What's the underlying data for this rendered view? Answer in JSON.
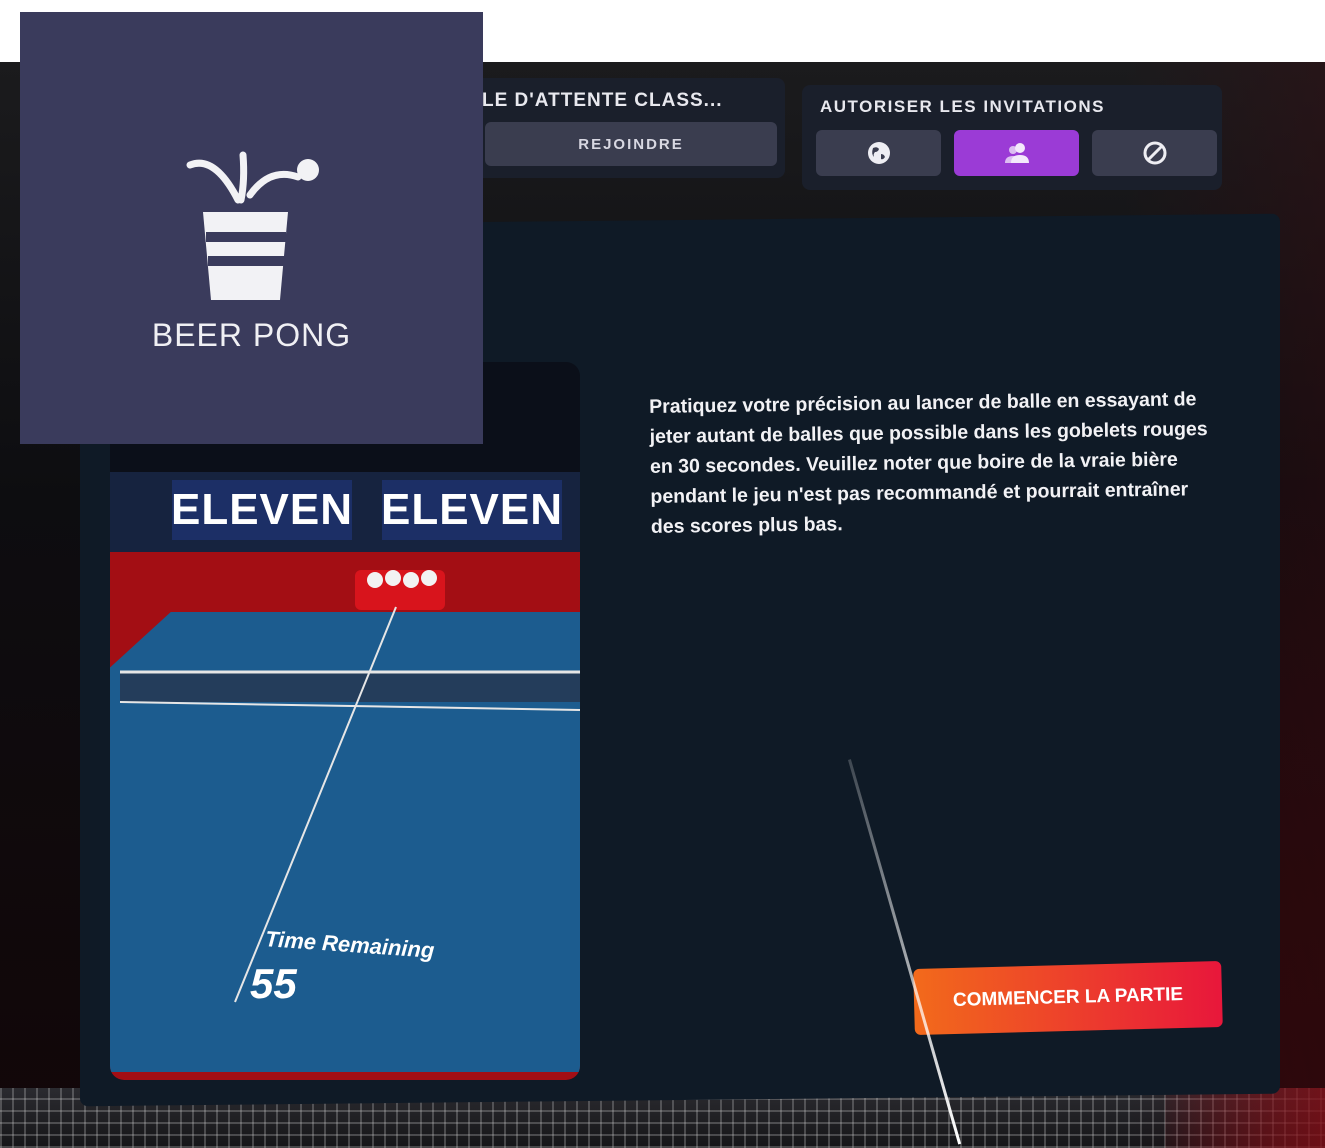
{
  "header": {
    "queue_title": "LE D'ATTENTE CLASS...",
    "join_label": "REJOINDRE",
    "invite_title": "AUTORISER LES INVITATIONS",
    "invite_options": [
      {
        "icon": "globe-icon",
        "selected": false
      },
      {
        "icon": "friends-icon",
        "selected": true
      },
      {
        "icon": "block-icon",
        "selected": false
      }
    ]
  },
  "mode_card": {
    "icon": "beer-pong-cup-icon",
    "label": "BEER PONG"
  },
  "preview": {
    "banner_text": "ELEVEN",
    "time_label": "Time Remaining",
    "time_value": "55"
  },
  "description": "Pratiquez votre précision au lancer de balle en essayant de jeter autant de balles que possible dans les gobelets rouges en 30 secondes. Veuillez noter que boire de la vraie bière pendant le jeu n'est pas recommandé et pourrait entraîner des scores plus bas.",
  "start_button": "COMMENCER LA PARTIE",
  "colors": {
    "panel": "#0f1a26",
    "card": "#3a3b5c",
    "selected_option": "#9b3bd6",
    "start_gradient_from": "#f26a1b",
    "start_gradient_to": "#e8173b"
  }
}
